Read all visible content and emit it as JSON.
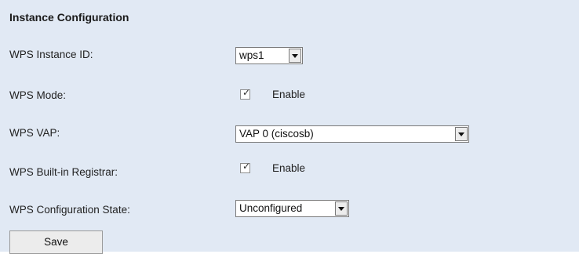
{
  "section": {
    "title": "Instance Configuration"
  },
  "rows": {
    "instance_id": {
      "label": "WPS Instance ID:",
      "value": "wps1"
    },
    "mode": {
      "label": "WPS Mode:",
      "checked": true,
      "option_label": "Enable"
    },
    "vap": {
      "label": "WPS VAP:",
      "value": "VAP 0 (ciscosb)"
    },
    "registrar": {
      "label": "WPS Built-in Registrar:",
      "checked": true,
      "option_label": "Enable"
    },
    "config_state": {
      "label": "WPS Configuration State:",
      "value": "Unconfigured"
    }
  },
  "actions": {
    "save_label": "Save"
  },
  "colors": {
    "panel_background": "#e1e9f4",
    "control_border": "#7a7a7a"
  }
}
